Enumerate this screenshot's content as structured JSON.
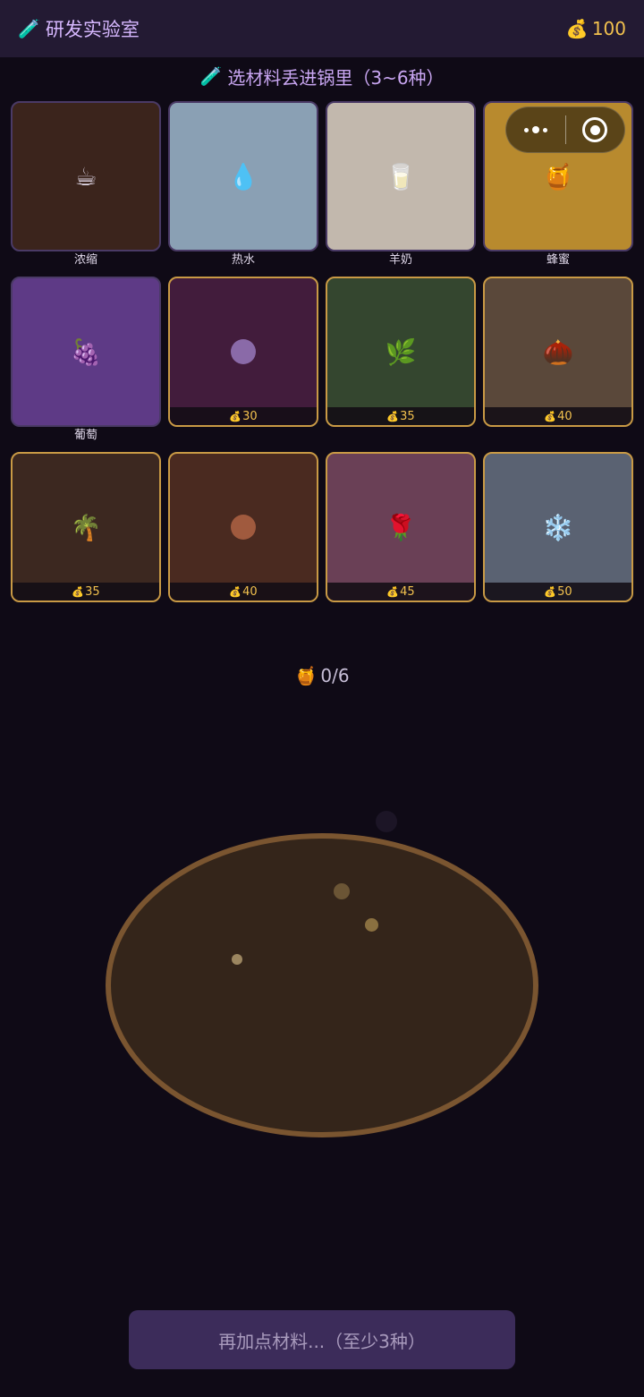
{
  "header": {
    "title_icon": "test-tube-icon",
    "title_emoji": "🧪",
    "title": "研发实验室",
    "coin_emoji": "💰",
    "coins": "100"
  },
  "instruction": {
    "emoji": "🧪",
    "text": "选材料丢进锅里（3~6种）"
  },
  "price_emoji": "💰",
  "ingredients": [
    {
      "name": "浓缩",
      "icon": "coffee-icon",
      "glyph": "☕",
      "owned": true,
      "bg": "#3b241c"
    },
    {
      "name": "热水",
      "icon": "water-drop-icon",
      "glyph": "💧",
      "owned": true,
      "bg": "#8aa0b4"
    },
    {
      "name": "羊奶",
      "icon": "milk-glass-icon",
      "glyph": "🥛",
      "owned": true,
      "bg": "#c2b8ad"
    },
    {
      "name": "蜂蜜",
      "icon": "honey-pot-icon",
      "glyph": "🍯",
      "owned": true,
      "bg": "#b88a2e"
    },
    {
      "name": "葡萄",
      "icon": "grapes-icon",
      "glyph": "🍇",
      "owned": true,
      "bg": "#5e3a86"
    },
    {
      "icon": "purple-dot-icon",
      "circle": "#8a6aa8",
      "owned": false,
      "price": "30",
      "bg": "#421c3c"
    },
    {
      "icon": "herb-icon",
      "glyph": "🌿",
      "owned": false,
      "price": "35",
      "bg": "#34462f"
    },
    {
      "icon": "chestnut-icon",
      "glyph": "🌰",
      "owned": false,
      "price": "40",
      "bg": "#5a483a"
    },
    {
      "icon": "palm-tree-icon",
      "glyph": "🌴",
      "owned": false,
      "price": "35",
      "bg": "#3c2820"
    },
    {
      "icon": "brown-dot-icon",
      "circle": "#a05a3e",
      "owned": false,
      "price": "40",
      "bg": "#4a2a20"
    },
    {
      "icon": "rose-icon",
      "glyph": "🌹",
      "owned": false,
      "price": "45",
      "bg": "#6a4056"
    },
    {
      "icon": "snowflake-icon",
      "glyph": "❄️",
      "owned": false,
      "price": "50",
      "bg": "#5a6272"
    }
  ],
  "counter": {
    "emoji": "🍯",
    "icon": "honey-pot-icon",
    "text": "0/6"
  },
  "pot": {
    "bg": "#34251a",
    "rim": "#7a5530"
  },
  "button": {
    "label": "再加点材料...（至少3种）"
  },
  "colors": {
    "gold": "#f2c14e",
    "accent_purple": "#c9a6f2",
    "background": "#0f0a16"
  }
}
